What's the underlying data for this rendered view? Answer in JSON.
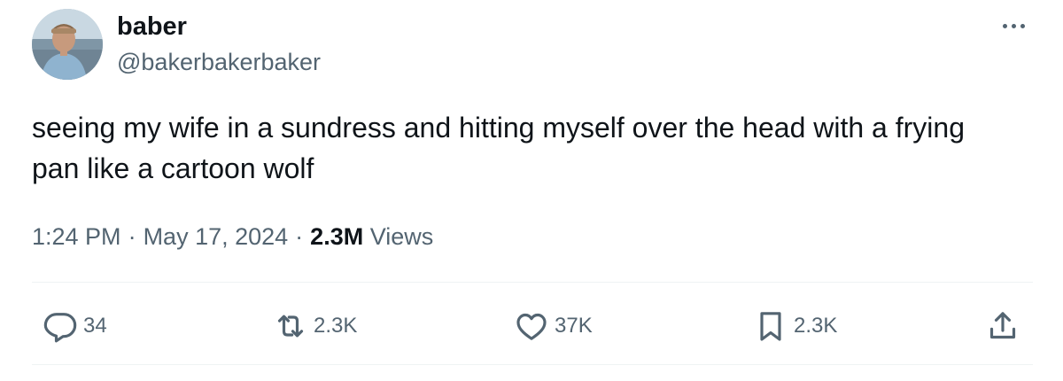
{
  "author": {
    "display_name": "baber",
    "handle": "@bakerbakerbaker"
  },
  "tweet": {
    "text": "seeing my wife in a sundress and hitting myself over the head with a frying pan like a cartoon wolf"
  },
  "meta": {
    "time": "1:24 PM",
    "separator": "·",
    "date": "May 17, 2024",
    "views_count": "2.3M",
    "views_label": "Views"
  },
  "actions": {
    "replies": "34",
    "retweets": "2.3K",
    "likes": "37K",
    "bookmarks": "2.3K"
  },
  "icons": {
    "reply": "reply-icon",
    "retweet": "retweet-icon",
    "like": "heart-icon",
    "bookmark": "bookmark-icon",
    "share": "share-icon",
    "more": "more-icon"
  },
  "colors": {
    "text_primary": "#0f1419",
    "text_secondary": "#536471",
    "divider": "#eff3f4"
  }
}
